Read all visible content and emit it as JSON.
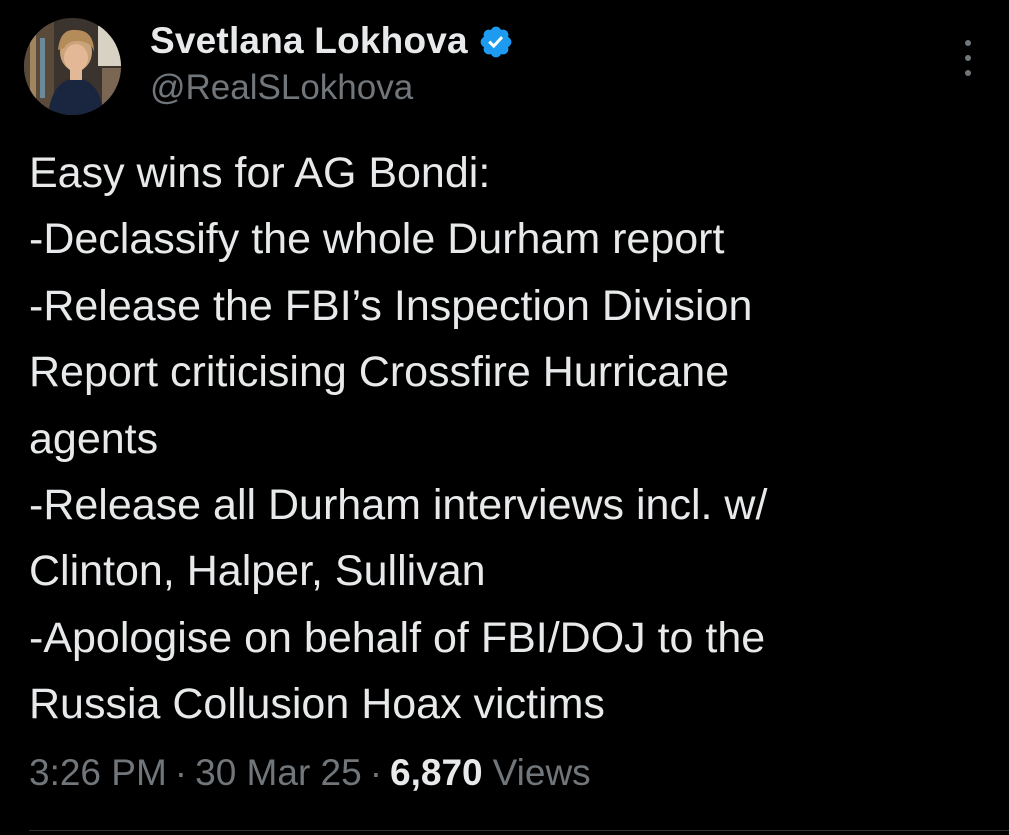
{
  "user": {
    "display_name": "Svetlana Lokhova",
    "handle": "@RealSLokhova",
    "verified": true
  },
  "tweet": {
    "lines": [
      "Easy wins for AG Bondi:",
      "-Declassify the whole Durham report",
      "-Release the FBI’s Inspection Division",
      "Report criticising Crossfire Hurricane",
      "agents",
      "-Release all Durham interviews incl. w/",
      "Clinton, Halper, Sullivan",
      "-Apologise on behalf of FBI/DOJ to the",
      "Russia Collusion Hoax victims"
    ]
  },
  "meta": {
    "time": "3:26 PM",
    "separator": "·",
    "date": "30 Mar 25",
    "views_count": "6,870",
    "views_label": "Views"
  },
  "icons": {
    "verified": "verified-badge-icon",
    "more": "more-options-icon"
  },
  "colors": {
    "background": "#000000",
    "text_primary": "#e7e9ea",
    "text_secondary": "#71767b",
    "verified_blue": "#1d9bf0",
    "divider": "#2f3336"
  }
}
